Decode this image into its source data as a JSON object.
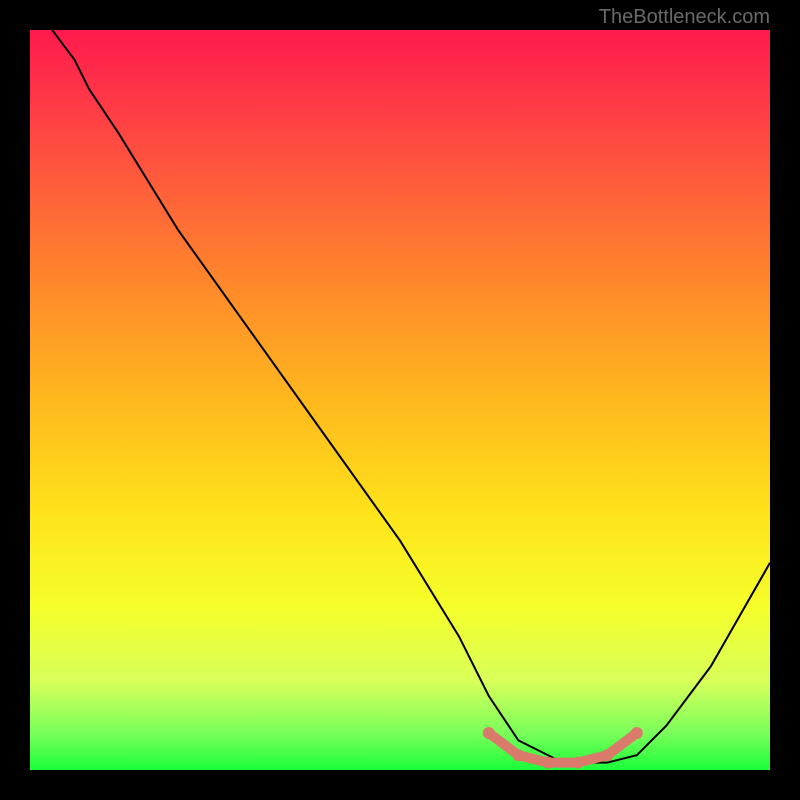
{
  "attribution": "TheBottleneck.com",
  "chart_data": {
    "type": "line",
    "title": "",
    "xlabel": "",
    "ylabel": "",
    "xlim": [
      0,
      100
    ],
    "ylim": [
      0,
      100
    ],
    "series": [
      {
        "name": "curve",
        "x": [
          3,
          6,
          8,
          12,
          20,
          30,
          40,
          50,
          58,
          62,
          66,
          72,
          78,
          82,
          86,
          92,
          100
        ],
        "values": [
          100,
          96,
          92,
          86,
          73,
          59,
          45,
          31,
          18,
          10,
          4,
          1,
          1,
          2,
          6,
          14,
          28
        ]
      }
    ],
    "highlight": {
      "name": "optimal-range",
      "x": [
        62,
        66,
        70,
        74,
        78,
        82
      ],
      "values": [
        5,
        2,
        1,
        1,
        2,
        5
      ]
    },
    "gradient_note": "background hue maps y position to bottleneck severity: red=high (top), green=low (bottom)"
  }
}
